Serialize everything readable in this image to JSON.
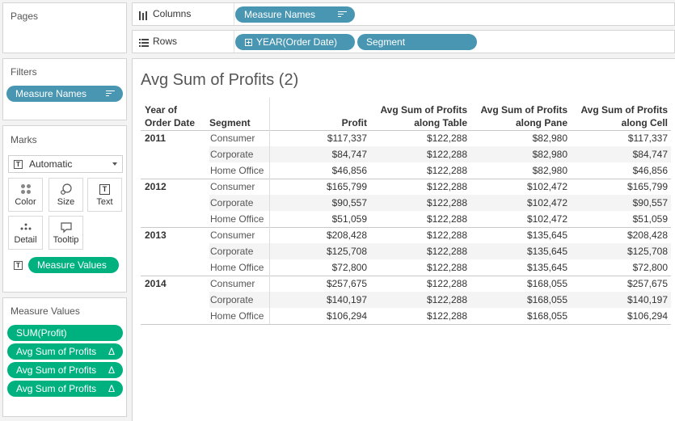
{
  "shelves": {
    "pages_title": "Pages",
    "columns_label": "Columns",
    "columns_pill": "Measure Names",
    "rows_label": "Rows",
    "rows_pills": [
      "YEAR(Order Date)",
      "Segment"
    ]
  },
  "filters": {
    "title": "Filters",
    "pill": "Measure Names"
  },
  "marks": {
    "title": "Marks",
    "type": "Automatic",
    "buttons": [
      "Color",
      "Size",
      "Text",
      "Detail",
      "Tooltip"
    ],
    "pill": "Measure Values"
  },
  "measure_values": {
    "title": "Measure Values",
    "pills": [
      "SUM(Profit)",
      "Avg Sum of Profits",
      "Avg Sum of Profits",
      "Avg Sum of Profits"
    ],
    "delta": "Δ"
  },
  "view": {
    "title": "Avg Sum of Profits (2)",
    "headers": {
      "year_line1": "Year of",
      "year_line2": "Order Date",
      "segment": "Segment",
      "profit": "Profit",
      "col2_line1": "Avg Sum of Profits",
      "col2_line2": "along Table",
      "col3_line1": "Avg Sum of Profits",
      "col3_line2": "along Pane",
      "col4_line1": "Avg Sum of Profits",
      "col4_line2": "along Cell"
    },
    "groups": [
      {
        "year": "2011",
        "rows": [
          {
            "segment": "Consumer",
            "profit": "$117,337",
            "table": "$122,288",
            "pane": "$82,980",
            "cell": "$117,337"
          },
          {
            "segment": "Corporate",
            "profit": "$84,747",
            "table": "$122,288",
            "pane": "$82,980",
            "cell": "$84,747"
          },
          {
            "segment": "Home Office",
            "profit": "$46,856",
            "table": "$122,288",
            "pane": "$82,980",
            "cell": "$46,856"
          }
        ]
      },
      {
        "year": "2012",
        "rows": [
          {
            "segment": "Consumer",
            "profit": "$165,799",
            "table": "$122,288",
            "pane": "$102,472",
            "cell": "$165,799"
          },
          {
            "segment": "Corporate",
            "profit": "$90,557",
            "table": "$122,288",
            "pane": "$102,472",
            "cell": "$90,557"
          },
          {
            "segment": "Home Office",
            "profit": "$51,059",
            "table": "$122,288",
            "pane": "$102,472",
            "cell": "$51,059"
          }
        ]
      },
      {
        "year": "2013",
        "rows": [
          {
            "segment": "Consumer",
            "profit": "$208,428",
            "table": "$122,288",
            "pane": "$135,645",
            "cell": "$208,428"
          },
          {
            "segment": "Corporate",
            "profit": "$125,708",
            "table": "$122,288",
            "pane": "$135,645",
            "cell": "$125,708"
          },
          {
            "segment": "Home Office",
            "profit": "$72,800",
            "table": "$122,288",
            "pane": "$135,645",
            "cell": "$72,800"
          }
        ]
      },
      {
        "year": "2014",
        "rows": [
          {
            "segment": "Consumer",
            "profit": "$257,675",
            "table": "$122,288",
            "pane": "$168,055",
            "cell": "$257,675"
          },
          {
            "segment": "Corporate",
            "profit": "$140,197",
            "table": "$122,288",
            "pane": "$168,055",
            "cell": "$140,197"
          },
          {
            "segment": "Home Office",
            "profit": "$106,294",
            "table": "$122,288",
            "pane": "$168,055",
            "cell": "$106,294"
          }
        ]
      }
    ]
  },
  "colors": {
    "dimension_pill": "#4996b2",
    "measure_pill": "#00b180"
  }
}
